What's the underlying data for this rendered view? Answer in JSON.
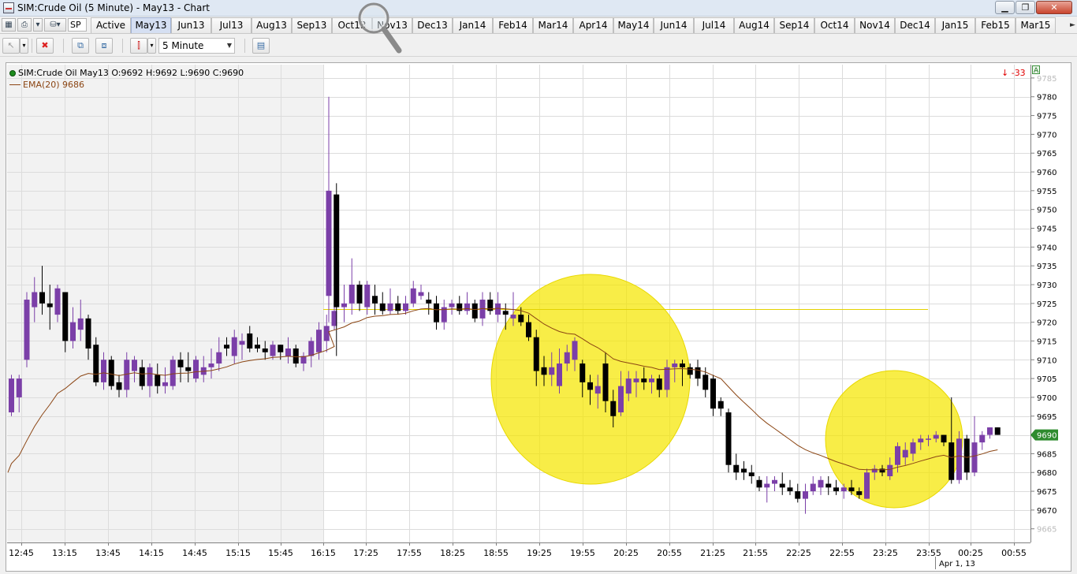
{
  "window": {
    "title": "SIM:Crude Oil (5 Minute) - May13 - Chart",
    "min_label": "▁",
    "max_label": "❐",
    "close_label": "✕"
  },
  "contract_bar": {
    "symbol_dropdown": "SP",
    "tabs": [
      "Active",
      "May13",
      "Jun13",
      "Jul13",
      "Aug13",
      "Sep13",
      "Oct13",
      "Nov13",
      "Dec13",
      "Jan14",
      "Feb14",
      "Mar14",
      "Apr14",
      "May14",
      "Jun14",
      "Jul14",
      "Aug14",
      "Sep14",
      "Oct14",
      "Nov14",
      "Dec14",
      "Jan15",
      "Feb15",
      "Mar15"
    ],
    "selected_tab": "May13",
    "scroll_glyph": "►"
  },
  "toolbar": {
    "interval": "5 Minute"
  },
  "legend": {
    "symbol_line": "SIM:Crude Oil May13 O:9692 H:9692 L:9690 C:9690",
    "ema_line": "EMA(20)  9686"
  },
  "pnl_indicator": {
    "arrow": "↓",
    "value": "-33"
  },
  "colors": {
    "up_candle": "#7b3fa8",
    "down_candle": "#000000",
    "ema": "#8b4513",
    "highlight": "#f5e600",
    "price_label_bg": "#2e8b2e",
    "pnl": "#e00000",
    "session_shade": "#f2f2f2"
  },
  "chart_data": {
    "type": "candlestick",
    "instrument": "SIM:Crude Oil May13",
    "interval": "5 Minute",
    "ylim": [
      9665,
      9785
    ],
    "y_ticks": [
      9665,
      9670,
      9675,
      9680,
      9685,
      9690,
      9695,
      9700,
      9705,
      9710,
      9715,
      9720,
      9725,
      9730,
      9735,
      9740,
      9745,
      9750,
      9755,
      9760,
      9765,
      9770,
      9775,
      9780,
      9785
    ],
    "x_ticks": [
      "12:45",
      "13:15",
      "13:45",
      "14:15",
      "14:45",
      "15:15",
      "15:45",
      "16:15",
      "17:25",
      "17:55",
      "18:25",
      "18:55",
      "19:25",
      "19:55",
      "20:25",
      "20:55",
      "21:25",
      "21:55",
      "22:25",
      "22:55",
      "23:25",
      "23:55",
      "00:25",
      "00:55"
    ],
    "date_marker": "Apr 1, 13",
    "last_price": "9690",
    "ema_label": "EMA(20)",
    "ema_last": 9686,
    "candles": [
      {
        "o": 9696,
        "h": 9706,
        "l": 9695,
        "c": 9705
      },
      {
        "o": 9700,
        "h": 9706,
        "l": 9696,
        "c": 9705
      },
      {
        "o": 9710,
        "h": 9728,
        "l": 9708,
        "c": 9726
      },
      {
        "o": 9724,
        "h": 9732,
        "l": 9720,
        "c": 9728
      },
      {
        "o": 9728,
        "h": 9735,
        "l": 9722,
        "c": 9725
      },
      {
        "o": 9725,
        "h": 9730,
        "l": 9718,
        "c": 9724
      },
      {
        "o": 9722,
        "h": 9730,
        "l": 9720,
        "c": 9729
      },
      {
        "o": 9728,
        "h": 9728,
        "l": 9712,
        "c": 9715
      },
      {
        "o": 9715,
        "h": 9724,
        "l": 9713,
        "c": 9720
      },
      {
        "o": 9718,
        "h": 9726,
        "l": 9715,
        "c": 9721
      },
      {
        "o": 9721,
        "h": 9722,
        "l": 9710,
        "c": 9713
      },
      {
        "o": 9714,
        "h": 9716,
        "l": 9703,
        "c": 9704
      },
      {
        "o": 9704,
        "h": 9712,
        "l": 9702,
        "c": 9710
      },
      {
        "o": 9710,
        "h": 9711,
        "l": 9702,
        "c": 9703
      },
      {
        "o": 9704,
        "h": 9706,
        "l": 9700,
        "c": 9702
      },
      {
        "o": 9702,
        "h": 9712,
        "l": 9700,
        "c": 9710
      },
      {
        "o": 9707,
        "h": 9711,
        "l": 9704,
        "c": 9710
      },
      {
        "o": 9708,
        "h": 9710,
        "l": 9702,
        "c": 9703
      },
      {
        "o": 9703,
        "h": 9709,
        "l": 9700,
        "c": 9708
      },
      {
        "o": 9706,
        "h": 9709,
        "l": 9701,
        "c": 9703
      },
      {
        "o": 9703,
        "h": 9708,
        "l": 9701,
        "c": 9704
      },
      {
        "o": 9703,
        "h": 9711,
        "l": 9702,
        "c": 9710
      },
      {
        "o": 9710,
        "h": 9712,
        "l": 9704,
        "c": 9708
      },
      {
        "o": 9708,
        "h": 9712,
        "l": 9704,
        "c": 9707
      },
      {
        "o": 9705,
        "h": 9711,
        "l": 9704,
        "c": 9710
      },
      {
        "o": 9706,
        "h": 9711,
        "l": 9704,
        "c": 9708
      },
      {
        "o": 9708,
        "h": 9713,
        "l": 9705,
        "c": 9709
      },
      {
        "o": 9709,
        "h": 9716,
        "l": 9707,
        "c": 9712
      },
      {
        "o": 9714,
        "h": 9716,
        "l": 9711,
        "c": 9713
      },
      {
        "o": 9711,
        "h": 9718,
        "l": 9709,
        "c": 9716
      },
      {
        "o": 9714,
        "h": 9717,
        "l": 9710,
        "c": 9715
      },
      {
        "o": 9717,
        "h": 9719,
        "l": 9712,
        "c": 9713
      },
      {
        "o": 9714,
        "h": 9716,
        "l": 9712,
        "c": 9713
      },
      {
        "o": 9713,
        "h": 9715,
        "l": 9710,
        "c": 9712
      },
      {
        "o": 9711,
        "h": 9715,
        "l": 9710,
        "c": 9714
      },
      {
        "o": 9714,
        "h": 9714,
        "l": 9710,
        "c": 9712
      },
      {
        "o": 9711,
        "h": 9716,
        "l": 9709,
        "c": 9713
      },
      {
        "o": 9713,
        "h": 9714,
        "l": 9708,
        "c": 9709
      },
      {
        "o": 9709,
        "h": 9712,
        "l": 9707,
        "c": 9711
      },
      {
        "o": 9711,
        "h": 9716,
        "l": 9708,
        "c": 9715
      },
      {
        "o": 9712,
        "h": 9720,
        "l": 9710,
        "c": 9718
      },
      {
        "o": 9715,
        "h": 9722,
        "l": 9712,
        "c": 9719
      },
      {
        "o": 9719,
        "h": 9725,
        "l": 9718,
        "c": 9723
      },
      {
        "o": 9727,
        "h": 9780,
        "l": 9720,
        "c": 9755
      },
      {
        "o": 9754,
        "h": 9757,
        "l": 9711,
        "c": 9724
      },
      {
        "o": 9724,
        "h": 9730,
        "l": 9720,
        "c": 9725
      },
      {
        "o": 9725,
        "h": 9737,
        "l": 9722,
        "c": 9730
      },
      {
        "o": 9730,
        "h": 9731,
        "l": 9723,
        "c": 9725
      },
      {
        "o": 9724,
        "h": 9731,
        "l": 9722,
        "c": 9730
      },
      {
        "o": 9727,
        "h": 9730,
        "l": 9722,
        "c": 9725
      },
      {
        "o": 9725,
        "h": 9728,
        "l": 9722,
        "c": 9723
      },
      {
        "o": 9723,
        "h": 9729,
        "l": 9722,
        "c": 9725
      },
      {
        "o": 9725,
        "h": 9727,
        "l": 9722,
        "c": 9723
      },
      {
        "o": 9723,
        "h": 9727,
        "l": 9722,
        "c": 9725
      },
      {
        "o": 9725,
        "h": 9731,
        "l": 9724,
        "c": 9729
      },
      {
        "o": 9727,
        "h": 9730,
        "l": 9726,
        "c": 9728
      },
      {
        "o": 9726,
        "h": 9728,
        "l": 9722,
        "c": 9725
      },
      {
        "o": 9725,
        "h": 9727,
        "l": 9718,
        "c": 9720
      },
      {
        "o": 9720,
        "h": 9726,
        "l": 9718,
        "c": 9724
      },
      {
        "o": 9724,
        "h": 9726,
        "l": 9722,
        "c": 9725
      },
      {
        "o": 9725,
        "h": 9727,
        "l": 9722,
        "c": 9723
      },
      {
        "o": 9723,
        "h": 9728,
        "l": 9722,
        "c": 9725
      },
      {
        "o": 9725,
        "h": 9726,
        "l": 9720,
        "c": 9721
      },
      {
        "o": 9721,
        "h": 9728,
        "l": 9719,
        "c": 9726
      },
      {
        "o": 9726,
        "h": 9728,
        "l": 9722,
        "c": 9723
      },
      {
        "o": 9722,
        "h": 9728,
        "l": 9720,
        "c": 9725
      },
      {
        "o": 9723,
        "h": 9725,
        "l": 9718,
        "c": 9722
      },
      {
        "o": 9721,
        "h": 9728,
        "l": 9719,
        "c": 9722
      },
      {
        "o": 9722,
        "h": 9724,
        "l": 9719,
        "c": 9720
      },
      {
        "o": 9720,
        "h": 9722,
        "l": 9715,
        "c": 9716
      },
      {
        "o": 9716,
        "h": 9718,
        "l": 9703,
        "c": 9707
      },
      {
        "o": 9708,
        "h": 9711,
        "l": 9703,
        "c": 9706
      },
      {
        "o": 9706,
        "h": 9712,
        "l": 9703,
        "c": 9708
      },
      {
        "o": 9703,
        "h": 9713,
        "l": 9701,
        "c": 9709
      },
      {
        "o": 9709,
        "h": 9714,
        "l": 9707,
        "c": 9712
      },
      {
        "o": 9710,
        "h": 9716,
        "l": 9707,
        "c": 9715
      },
      {
        "o": 9709,
        "h": 9710,
        "l": 9700,
        "c": 9704
      },
      {
        "o": 9704,
        "h": 9706,
        "l": 9698,
        "c": 9702
      },
      {
        "o": 9701,
        "h": 9706,
        "l": 9697,
        "c": 9703
      },
      {
        "o": 9709,
        "h": 9712,
        "l": 9696,
        "c": 9699
      },
      {
        "o": 9699,
        "h": 9702,
        "l": 9692,
        "c": 9695
      },
      {
        "o": 9696,
        "h": 9707,
        "l": 9695,
        "c": 9703
      },
      {
        "o": 9701,
        "h": 9707,
        "l": 9699,
        "c": 9705
      },
      {
        "o": 9704,
        "h": 9707,
        "l": 9700,
        "c": 9705
      },
      {
        "o": 9705,
        "h": 9708,
        "l": 9702,
        "c": 9704
      },
      {
        "o": 9704,
        "h": 9706,
        "l": 9701,
        "c": 9705
      },
      {
        "o": 9705,
        "h": 9706,
        "l": 9700,
        "c": 9702
      },
      {
        "o": 9702,
        "h": 9710,
        "l": 9700,
        "c": 9708
      },
      {
        "o": 9708,
        "h": 9710,
        "l": 9704,
        "c": 9709
      },
      {
        "o": 9709,
        "h": 9710,
        "l": 9703,
        "c": 9708
      },
      {
        "o": 9708,
        "h": 9709,
        "l": 9705,
        "c": 9706
      },
      {
        "o": 9708,
        "h": 9710,
        "l": 9703,
        "c": 9705
      },
      {
        "o": 9706,
        "h": 9708,
        "l": 9700,
        "c": 9702
      },
      {
        "o": 9705,
        "h": 9706,
        "l": 9695,
        "c": 9697
      },
      {
        "o": 9699,
        "h": 9700,
        "l": 9695,
        "c": 9697
      },
      {
        "o": 9696,
        "h": 9697,
        "l": 9680,
        "c": 9682
      },
      {
        "o": 9682,
        "h": 9685,
        "l": 9678,
        "c": 9680
      },
      {
        "o": 9681,
        "h": 9683,
        "l": 9678,
        "c": 9680
      },
      {
        "o": 9680,
        "h": 9682,
        "l": 9677,
        "c": 9679
      },
      {
        "o": 9678,
        "h": 9679,
        "l": 9675,
        "c": 9676
      },
      {
        "o": 9676,
        "h": 9679,
        "l": 9672,
        "c": 9677
      },
      {
        "o": 9677,
        "h": 9679,
        "l": 9675,
        "c": 9678
      },
      {
        "o": 9677,
        "h": 9680,
        "l": 9674,
        "c": 9676
      },
      {
        "o": 9676,
        "h": 9678,
        "l": 9674,
        "c": 9675
      },
      {
        "o": 9675,
        "h": 9677,
        "l": 9672,
        "c": 9673
      },
      {
        "o": 9673,
        "h": 9677,
        "l": 9669,
        "c": 9675
      },
      {
        "o": 9675,
        "h": 9679,
        "l": 9674,
        "c": 9677
      },
      {
        "o": 9676,
        "h": 9679,
        "l": 9674,
        "c": 9678
      },
      {
        "o": 9677,
        "h": 9679,
        "l": 9674,
        "c": 9676
      },
      {
        "o": 9676,
        "h": 9678,
        "l": 9674,
        "c": 9675
      },
      {
        "o": 9675,
        "h": 9677,
        "l": 9673,
        "c": 9676
      },
      {
        "o": 9676,
        "h": 9678,
        "l": 9674,
        "c": 9675
      },
      {
        "o": 9675,
        "h": 9676,
        "l": 9673,
        "c": 9674
      },
      {
        "o": 9673,
        "h": 9681,
        "l": 9673,
        "c": 9680
      },
      {
        "o": 9680,
        "h": 9682,
        "l": 9678,
        "c": 9681
      },
      {
        "o": 9681,
        "h": 9682,
        "l": 9679,
        "c": 9680
      },
      {
        "o": 9679,
        "h": 9684,
        "l": 9678,
        "c": 9682
      },
      {
        "o": 9682,
        "h": 9688,
        "l": 9680,
        "c": 9687
      },
      {
        "o": 9684,
        "h": 9688,
        "l": 9682,
        "c": 9686
      },
      {
        "o": 9685,
        "h": 9689,
        "l": 9683,
        "c": 9688
      },
      {
        "o": 9688,
        "h": 9690,
        "l": 9686,
        "c": 9689
      },
      {
        "o": 9689,
        "h": 9690,
        "l": 9687,
        "c": 9689
      },
      {
        "o": 9689,
        "h": 9691,
        "l": 9688,
        "c": 9690
      },
      {
        "o": 9690,
        "h": 9690,
        "l": 9687,
        "c": 9688
      },
      {
        "o": 9688,
        "h": 9700,
        "l": 9677,
        "c": 9678
      },
      {
        "o": 9678,
        "h": 9691,
        "l": 9677,
        "c": 9689
      },
      {
        "o": 9689,
        "h": 9690,
        "l": 9678,
        "c": 9680
      },
      {
        "o": 9680,
        "h": 9695,
        "l": 9679,
        "c": 9688
      },
      {
        "o": 9688,
        "h": 9691,
        "l": 9686,
        "c": 9690
      },
      {
        "o": 9690,
        "h": 9692,
        "l": 9689,
        "c": 9692
      },
      {
        "o": 9692,
        "h": 9692,
        "l": 9690,
        "c": 9690
      }
    ]
  }
}
